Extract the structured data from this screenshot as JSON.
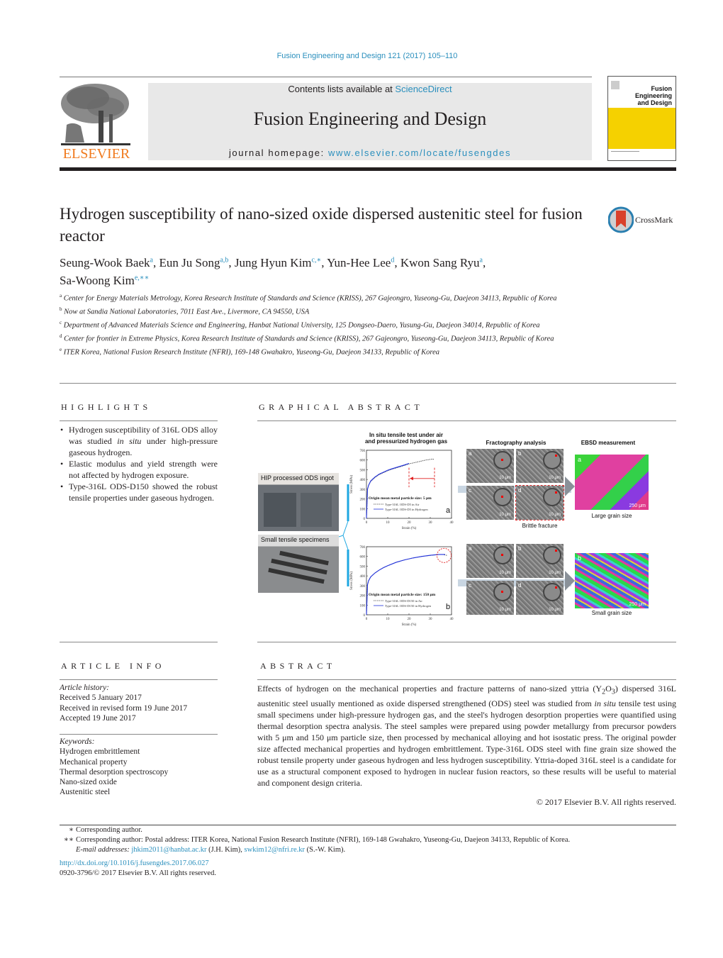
{
  "header": {
    "citation": "Fusion Engineering and Design 121 (2017) 105–110",
    "contents_prefix": "Contents lists available at ",
    "contents_link": "ScienceDirect",
    "journal_name": "Fusion Engineering and Design",
    "homepage_prefix": "journal homepage: ",
    "homepage_link": "www.elsevier.com/locate/fusengdes",
    "publisher_logo_text": "ELSEVIER",
    "cover_title_line1": "Fusion Engineering",
    "cover_title_line2": "and Design",
    "cover_color": "#f5d100",
    "brand_color": "#f07a1e",
    "link_color": "#2a8fbd"
  },
  "article": {
    "title": "Hydrogen susceptibility of nano-sized oxide dispersed austenitic steel for fusion reactor",
    "crossmark_label": "CrossMark",
    "authors": [
      {
        "name": "Seung-Wook Baek",
        "sup": "a",
        "sep": ", "
      },
      {
        "name": "Eun Ju Song",
        "sup": "a,b",
        "sep": ", "
      },
      {
        "name": "Jung Hyun Kim",
        "sup": "c,∗",
        "sep": ", "
      },
      {
        "name": "Yun-Hee Lee",
        "sup": "d",
        "sep": ", "
      },
      {
        "name": "Kwon Sang Ryu",
        "sup": "a",
        "sep": ","
      },
      {
        "name": "Sa-Woong Kim",
        "sup": "e,∗∗",
        "sep": ""
      }
    ],
    "affiliations": [
      {
        "mark": "a",
        "text": "Center for Energy Materials Metrology, Korea Research Institute of Standards and Science (KRISS), 267 Gajeongro, Yuseong-Gu, Daejeon 34113, Republic of Korea"
      },
      {
        "mark": "b",
        "text": "Now at Sandia National Laboratories, 7011 East Ave., Livermore, CA 94550, USA"
      },
      {
        "mark": "c",
        "text": "Department of Advanced Materials Science and Engineering, Hanbat National University, 125 Dongseo-Daero, Yusung-Gu, Daejeon 34014, Republic of Korea"
      },
      {
        "mark": "d",
        "text": "Center for frontier in Extreme Physics, Korea Research Institute of Standards and Science (KRISS), 267 Gajeongro, Yuseong-Gu, Daejeon 34113, Republic of Korea"
      },
      {
        "mark": "e",
        "text": "ITER Korea, National Fusion Research Institute (NFRI), 169-148 Gwahakro, Yuseong-Gu, Daejeon 34133, Republic of Korea"
      }
    ]
  },
  "highlights": {
    "heading": "HIGHLIGHTS",
    "items": [
      {
        "before": "Hydrogen susceptibility of 316L ODS alloy was studied ",
        "italic": "in situ",
        "after": " under high-pressure gaseous hydrogen."
      },
      {
        "before": "Elastic modulus and yield strength were not affected by hydrogen exposure.",
        "italic": "",
        "after": ""
      },
      {
        "before": "Type-316L ODS-D150 showed the robust tensile properties under gaseous hydrogen.",
        "italic": "",
        "after": ""
      }
    ]
  },
  "graphical_abstract": {
    "heading": "GRAPHICAL ABSTRACT",
    "photo1_label": "HIP processed ODS ingot",
    "photo2_label": "Small tensile specimens",
    "chart_title_line1": "In situ tensile test under air",
    "chart_title_line2": "and pressurized hydrogen gas",
    "fracto_title": "Fractography analysis",
    "ebsd_title": "EBSD measurement",
    "brittle_label": "Brittle fracture",
    "large_grain_label": "Large grain size",
    "small_grain_label": "Small grain size",
    "sem_scale": "10 μm",
    "ebsd_scale": "250 μm",
    "sem_letters": [
      "a",
      "b",
      "c",
      "d"
    ],
    "ebsd_letters": [
      "a",
      "b"
    ]
  },
  "chart_data": [
    {
      "type": "line",
      "panel": "a",
      "title": "In situ tensile test under air and pressurized hydrogen gas",
      "annotation": "Origin mean metal particle size: 5 μm",
      "xlabel": "Strain (%)",
      "ylabel": "Stress (MPa)",
      "xlim": [
        0,
        40
      ],
      "ylim": [
        0,
        700
      ],
      "xticks": [
        0,
        10,
        20,
        30,
        40
      ],
      "yticks": [
        0,
        100,
        200,
        300,
        400,
        500,
        600,
        700
      ],
      "series": [
        {
          "name": "Type-316L ODS-D5 in Air",
          "style": "dotted",
          "color": "#444444",
          "x": [
            0,
            0.5,
            1,
            2,
            4,
            6,
            8,
            10,
            12,
            15,
            18,
            20,
            24,
            28,
            31,
            32
          ],
          "y": [
            0,
            300,
            340,
            380,
            420,
            450,
            470,
            490,
            505,
            525,
            545,
            560,
            580,
            600,
            610,
            605
          ]
        },
        {
          "name": "Type-316L ODS-D5 in Hydrogen",
          "style": "solid",
          "color": "#2233dd",
          "x": [
            0,
            0.5,
            1,
            2,
            4,
            6,
            8,
            10,
            12,
            15,
            18,
            20
          ],
          "y": [
            0,
            300,
            340,
            385,
            425,
            455,
            475,
            495,
            510,
            530,
            550,
            565
          ]
        }
      ]
    },
    {
      "type": "line",
      "panel": "b",
      "annotation": "Origin mean metal particle size: 150 μm",
      "xlabel": "Strain (%)",
      "ylabel": "Stress (MPa)",
      "xlim": [
        0,
        40
      ],
      "ylim": [
        0,
        700
      ],
      "xticks": [
        0,
        10,
        20,
        30,
        40
      ],
      "yticks": [
        0,
        100,
        200,
        300,
        400,
        500,
        600,
        700
      ],
      "series": [
        {
          "name": "Type-316L ODS-D150 in Air",
          "style": "dotted",
          "color": "#444444",
          "x": [
            0,
            0.5,
            1,
            2,
            4,
            6,
            8,
            10,
            14,
            18,
            22,
            26,
            30,
            34,
            36,
            38
          ],
          "y": [
            0,
            310,
            350,
            390,
            430,
            460,
            485,
            505,
            540,
            565,
            585,
            600,
            610,
            620,
            620,
            610
          ]
        },
        {
          "name": "Type-316L ODS-D150 in Hydrogen",
          "style": "solid",
          "color": "#2233dd",
          "x": [
            0,
            0.5,
            1,
            2,
            4,
            6,
            8,
            10,
            14,
            18,
            22,
            26,
            30,
            34,
            37
          ],
          "y": [
            0,
            310,
            350,
            390,
            430,
            460,
            485,
            505,
            540,
            565,
            585,
            600,
            612,
            620,
            620
          ]
        }
      ]
    }
  ],
  "article_info": {
    "heading": "ARTICLE INFO",
    "history_label": "Article history:",
    "history": [
      "Received 5 January 2017",
      "Received in revised form 19 June 2017",
      "Accepted 19 June 2017"
    ],
    "keywords_label": "Keywords:",
    "keywords": [
      "Hydrogen embrittlement",
      "Mechanical property",
      "Thermal desorption spectroscopy",
      "Nano-sized oxide",
      "Austenitic steel"
    ]
  },
  "abstract": {
    "heading": "ABSTRACT",
    "part1": "Effects of hydrogen on the mechanical properties and fracture patterns of nano-sized yttria (Y",
    "sub1": "2",
    "part2": "O",
    "sub2": "3",
    "part3": ") dispersed 316L austenitic steel usually mentioned as oxide dispersed strengthened (ODS) steel was studied from ",
    "italic": "in situ",
    "part4": " tensile test using small specimens under high-pressure hydrogen gas, and the steel's hydrogen desorption properties were quantified using thermal desorption spectra analysis. The steel samples were prepared using powder metallurgy from precursor powders with 5 μm and 150 μm particle size, then processed by mechanical alloying and hot isostatic press. The original powder size affected mechanical properties and hydrogen embrittlement. Type-316L ODS steel with fine grain size showed the robust tensile property under gaseous hydrogen and less hydrogen susceptibility. Yttria-doped 316L steel is a candidate for use as a structural component exposed to hydrogen in nuclear fusion reactors, so these results will be useful to material and component design criteria.",
    "copyright": "© 2017 Elsevier B.V. All rights reserved."
  },
  "footnotes": {
    "fn1_mark": "∗",
    "fn1_text": "Corresponding author.",
    "fn2_mark": "∗∗",
    "fn2_text": "Corresponding author: Postal address: ITER Korea, National Fusion Research Institute (NFRI), 169-148 Gwahakro, Yuseong-Gu, Daejeon 34133, Republic of Korea.",
    "email_label": "E-mail addresses:",
    "email1": "jhkim2011@hanbat.ac.kr",
    "email1_who": " (J.H. Kim), ",
    "email2": "swkim12@nfri.re.kr",
    "email2_who": " (S.-W. Kim).",
    "doi": "http://dx.doi.org/10.1016/j.fusengdes.2017.06.027",
    "issn": "0920-3796/© 2017 Elsevier B.V. All rights reserved."
  }
}
